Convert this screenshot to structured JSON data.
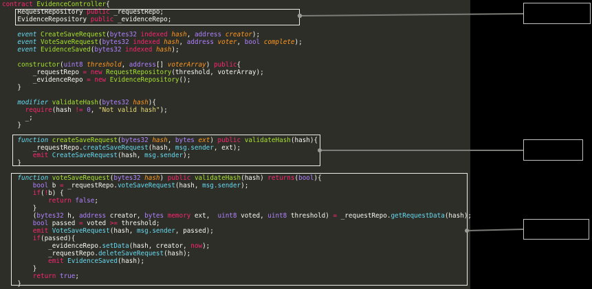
{
  "colors": {
    "editor_background": "#2e2e28",
    "side_panel_background": "#000000",
    "keyword": "#f92672",
    "declaration_keyword": "#66d9ef",
    "definition_name": "#a6e22e",
    "type": "#ae81ff",
    "parameter": "#fd971f",
    "member_call": "#66d9ef",
    "string": "#e6db74",
    "plain_text": "#f8f8f2",
    "highlight_box_border": "#eeeeea",
    "annotation_box_border": "#c4c4c2",
    "connector_line": "#7c7c78"
  },
  "code": {
    "lines": [
      [
        {
          "c": "kw",
          "t": "contract "
        },
        {
          "c": "name",
          "t": "EvidenceController"
        },
        {
          "c": "plain",
          "t": "{"
        }
      ],
      [
        {
          "c": "plain",
          "t": "    RequestRepository "
        },
        {
          "c": "kw",
          "t": "public"
        },
        {
          "c": "plain",
          "t": " _requestRepo;"
        }
      ],
      [
        {
          "c": "plain",
          "t": "    EvidenceRepository "
        },
        {
          "c": "kw",
          "t": "public"
        },
        {
          "c": "plain",
          "t": " _evidenceRepo;"
        }
      ],
      [],
      [
        {
          "c": "plain",
          "t": "    "
        },
        {
          "c": "decl",
          "t": "event "
        },
        {
          "c": "name",
          "t": "CreateSaveRequest"
        },
        {
          "c": "plain",
          "t": "("
        },
        {
          "c": "type",
          "t": "bytes32"
        },
        {
          "c": "plain",
          "t": " "
        },
        {
          "c": "kw",
          "t": "indexed"
        },
        {
          "c": "plain",
          "t": " "
        },
        {
          "c": "param",
          "t": "hash"
        },
        {
          "c": "plain",
          "t": ", "
        },
        {
          "c": "type",
          "t": "address"
        },
        {
          "c": "plain",
          "t": " "
        },
        {
          "c": "param",
          "t": "creator"
        },
        {
          "c": "plain",
          "t": ");"
        }
      ],
      [
        {
          "c": "plain",
          "t": "    "
        },
        {
          "c": "decl",
          "t": "event "
        },
        {
          "c": "name",
          "t": "VoteSaveRequest"
        },
        {
          "c": "plain",
          "t": "("
        },
        {
          "c": "type",
          "t": "bytes32"
        },
        {
          "c": "plain",
          "t": " "
        },
        {
          "c": "kw",
          "t": "indexed"
        },
        {
          "c": "plain",
          "t": " "
        },
        {
          "c": "param",
          "t": "hash"
        },
        {
          "c": "plain",
          "t": ", "
        },
        {
          "c": "type",
          "t": "address"
        },
        {
          "c": "plain",
          "t": " "
        },
        {
          "c": "param",
          "t": "voter"
        },
        {
          "c": "plain",
          "t": ", "
        },
        {
          "c": "type",
          "t": "bool"
        },
        {
          "c": "plain",
          "t": " "
        },
        {
          "c": "param",
          "t": "complete"
        },
        {
          "c": "plain",
          "t": ");"
        }
      ],
      [
        {
          "c": "plain",
          "t": "    "
        },
        {
          "c": "decl",
          "t": "event "
        },
        {
          "c": "name",
          "t": "EvidenceSaved"
        },
        {
          "c": "plain",
          "t": "("
        },
        {
          "c": "type",
          "t": "bytes32"
        },
        {
          "c": "plain",
          "t": " "
        },
        {
          "c": "kw",
          "t": "indexed"
        },
        {
          "c": "plain",
          "t": " "
        },
        {
          "c": "param",
          "t": "hash"
        },
        {
          "c": "plain",
          "t": ");"
        }
      ],
      [],
      [
        {
          "c": "plain",
          "t": "    "
        },
        {
          "c": "name",
          "t": "constructor"
        },
        {
          "c": "plain",
          "t": "("
        },
        {
          "c": "type",
          "t": "uint8"
        },
        {
          "c": "plain",
          "t": " "
        },
        {
          "c": "param",
          "t": "threshold"
        },
        {
          "c": "plain",
          "t": ", "
        },
        {
          "c": "type",
          "t": "address"
        },
        {
          "c": "plain",
          "t": "[] "
        },
        {
          "c": "param",
          "t": "voterArray"
        },
        {
          "c": "plain",
          "t": ") "
        },
        {
          "c": "kw",
          "t": "public"
        },
        {
          "c": "plain",
          "t": "{"
        }
      ],
      [
        {
          "c": "plain",
          "t": "        _requestRepo "
        },
        {
          "c": "kw",
          "t": "="
        },
        {
          "c": "plain",
          "t": " "
        },
        {
          "c": "kw",
          "t": "new"
        },
        {
          "c": "plain",
          "t": " "
        },
        {
          "c": "name",
          "t": "RequestRepository"
        },
        {
          "c": "plain",
          "t": "(threshold, voterArray);"
        }
      ],
      [
        {
          "c": "plain",
          "t": "        _evidenceRepo "
        },
        {
          "c": "kw",
          "t": "="
        },
        {
          "c": "plain",
          "t": " "
        },
        {
          "c": "kw",
          "t": "new"
        },
        {
          "c": "plain",
          "t": " "
        },
        {
          "c": "name",
          "t": "EvidenceRepository"
        },
        {
          "c": "plain",
          "t": "();"
        }
      ],
      [
        {
          "c": "plain",
          "t": "    }"
        }
      ],
      [],
      [
        {
          "c": "plain",
          "t": "    "
        },
        {
          "c": "decl",
          "t": "modifier "
        },
        {
          "c": "name",
          "t": "validateHash"
        },
        {
          "c": "plain",
          "t": "("
        },
        {
          "c": "type",
          "t": "bytes32"
        },
        {
          "c": "plain",
          "t": " "
        },
        {
          "c": "param",
          "t": "hash"
        },
        {
          "c": "plain",
          "t": "){"
        }
      ],
      [
        {
          "c": "plain",
          "t": "      "
        },
        {
          "c": "kw",
          "t": "require"
        },
        {
          "c": "plain",
          "t": "(hash "
        },
        {
          "c": "kw",
          "t": "!="
        },
        {
          "c": "plain",
          "t": " "
        },
        {
          "c": "type",
          "t": "0"
        },
        {
          "c": "plain",
          "t": ", "
        },
        {
          "c": "str",
          "t": "\"Not valid hash\""
        },
        {
          "c": "plain",
          "t": ");"
        }
      ],
      [
        {
          "c": "plain",
          "t": "      _;"
        }
      ],
      [
        {
          "c": "plain",
          "t": "    }"
        }
      ],
      [],
      [
        {
          "c": "plain",
          "t": "    "
        },
        {
          "c": "decl",
          "t": "function "
        },
        {
          "c": "name",
          "t": "createSaveRequest"
        },
        {
          "c": "plain",
          "t": "("
        },
        {
          "c": "type",
          "t": "bytes32"
        },
        {
          "c": "plain",
          "t": " "
        },
        {
          "c": "param",
          "t": "hash"
        },
        {
          "c": "plain",
          "t": ", "
        },
        {
          "c": "type",
          "t": "bytes"
        },
        {
          "c": "plain",
          "t": " "
        },
        {
          "c": "param",
          "t": "ext"
        },
        {
          "c": "plain",
          "t": ") "
        },
        {
          "c": "kw",
          "t": "public"
        },
        {
          "c": "plain",
          "t": " "
        },
        {
          "c": "name",
          "t": "validateHash"
        },
        {
          "c": "plain",
          "t": "(hash){"
        }
      ],
      [
        {
          "c": "plain",
          "t": "        _requestRepo."
        },
        {
          "c": "member",
          "t": "createSaveRequest"
        },
        {
          "c": "plain",
          "t": "(hash, "
        },
        {
          "c": "member",
          "t": "msg.sender"
        },
        {
          "c": "plain",
          "t": ", ext);"
        }
      ],
      [
        {
          "c": "plain",
          "t": "        "
        },
        {
          "c": "kw",
          "t": "emit"
        },
        {
          "c": "plain",
          "t": " "
        },
        {
          "c": "member",
          "t": "CreateSaveRequest"
        },
        {
          "c": "plain",
          "t": "(hash, "
        },
        {
          "c": "member",
          "t": "msg.sender"
        },
        {
          "c": "plain",
          "t": ");"
        }
      ],
      [
        {
          "c": "plain",
          "t": "    }"
        }
      ],
      [],
      [
        {
          "c": "plain",
          "t": "    "
        },
        {
          "c": "decl",
          "t": "function "
        },
        {
          "c": "name",
          "t": "voteSaveRequest"
        },
        {
          "c": "plain",
          "t": "("
        },
        {
          "c": "type",
          "t": "bytes32"
        },
        {
          "c": "plain",
          "t": " "
        },
        {
          "c": "param",
          "t": "hash"
        },
        {
          "c": "plain",
          "t": ") "
        },
        {
          "c": "kw",
          "t": "public"
        },
        {
          "c": "plain",
          "t": " "
        },
        {
          "c": "name",
          "t": "validateHash"
        },
        {
          "c": "plain",
          "t": "(hash) "
        },
        {
          "c": "kw",
          "t": "returns"
        },
        {
          "c": "plain",
          "t": "("
        },
        {
          "c": "type",
          "t": "bool"
        },
        {
          "c": "plain",
          "t": "){"
        }
      ],
      [
        {
          "c": "plain",
          "t": "        "
        },
        {
          "c": "type",
          "t": "bool"
        },
        {
          "c": "plain",
          "t": " b "
        },
        {
          "c": "kw",
          "t": "="
        },
        {
          "c": "plain",
          "t": " _requestRepo."
        },
        {
          "c": "member",
          "t": "voteSaveRequest"
        },
        {
          "c": "plain",
          "t": "(hash, "
        },
        {
          "c": "member",
          "t": "msg.sender"
        },
        {
          "c": "plain",
          "t": ");"
        }
      ],
      [
        {
          "c": "plain",
          "t": "        "
        },
        {
          "c": "kw",
          "t": "if"
        },
        {
          "c": "plain",
          "t": "("
        },
        {
          "c": "kw",
          "t": "!"
        },
        {
          "c": "plain",
          "t": "b) {"
        }
      ],
      [
        {
          "c": "plain",
          "t": "            "
        },
        {
          "c": "kw",
          "t": "return"
        },
        {
          "c": "plain",
          "t": " "
        },
        {
          "c": "type",
          "t": "false"
        },
        {
          "c": "plain",
          "t": ";"
        }
      ],
      [
        {
          "c": "plain",
          "t": "        }"
        }
      ],
      [
        {
          "c": "plain",
          "t": "        ("
        },
        {
          "c": "type",
          "t": "bytes32"
        },
        {
          "c": "plain",
          "t": " h, "
        },
        {
          "c": "type",
          "t": "address"
        },
        {
          "c": "plain",
          "t": " creator, "
        },
        {
          "c": "type",
          "t": "bytes"
        },
        {
          "c": "plain",
          "t": " "
        },
        {
          "c": "kw",
          "t": "memory"
        },
        {
          "c": "plain",
          "t": " ext,  "
        },
        {
          "c": "type",
          "t": "uint8"
        },
        {
          "c": "plain",
          "t": " voted, "
        },
        {
          "c": "type",
          "t": "uint8"
        },
        {
          "c": "plain",
          "t": " threshold) "
        },
        {
          "c": "kw",
          "t": "="
        },
        {
          "c": "plain",
          "t": " _requestRepo."
        },
        {
          "c": "member",
          "t": "getRequestData"
        },
        {
          "c": "plain",
          "t": "(hash);"
        }
      ],
      [
        {
          "c": "plain",
          "t": "        "
        },
        {
          "c": "type",
          "t": "bool"
        },
        {
          "c": "plain",
          "t": " passed "
        },
        {
          "c": "kw",
          "t": "="
        },
        {
          "c": "plain",
          "t": " voted "
        },
        {
          "c": "kw",
          "t": ">="
        },
        {
          "c": "plain",
          "t": " threshold;"
        }
      ],
      [
        {
          "c": "plain",
          "t": "        "
        },
        {
          "c": "kw",
          "t": "emit"
        },
        {
          "c": "plain",
          "t": " "
        },
        {
          "c": "member",
          "t": "VoteSaveRequest"
        },
        {
          "c": "plain",
          "t": "(hash, "
        },
        {
          "c": "member",
          "t": "msg.sender"
        },
        {
          "c": "plain",
          "t": ", passed);"
        }
      ],
      [
        {
          "c": "plain",
          "t": "        "
        },
        {
          "c": "kw",
          "t": "if"
        },
        {
          "c": "plain",
          "t": "(passed){"
        }
      ],
      [
        {
          "c": "plain",
          "t": "            _evidenceRepo."
        },
        {
          "c": "member",
          "t": "setData"
        },
        {
          "c": "plain",
          "t": "(hash, creator, "
        },
        {
          "c": "kw",
          "t": "now"
        },
        {
          "c": "plain",
          "t": ");"
        }
      ],
      [
        {
          "c": "plain",
          "t": "            _requestRepo."
        },
        {
          "c": "member",
          "t": "deleteSaveRequest"
        },
        {
          "c": "plain",
          "t": "(hash);"
        }
      ],
      [
        {
          "c": "plain",
          "t": "            "
        },
        {
          "c": "kw",
          "t": "emit"
        },
        {
          "c": "plain",
          "t": " "
        },
        {
          "c": "member",
          "t": "EvidenceSaved"
        },
        {
          "c": "plain",
          "t": "(hash);"
        }
      ],
      [
        {
          "c": "plain",
          "t": "        }"
        }
      ],
      [
        {
          "c": "plain",
          "t": "        "
        },
        {
          "c": "kw",
          "t": "return"
        },
        {
          "c": "plain",
          "t": " "
        },
        {
          "c": "type",
          "t": "true"
        },
        {
          "c": "plain",
          "t": ";"
        }
      ],
      [
        {
          "c": "plain",
          "t": "    }"
        }
      ]
    ]
  },
  "annotations": {
    "highlight_boxes": [
      {
        "target": "state-variable-declarations"
      },
      {
        "target": "createSaveRequest-function"
      },
      {
        "target": "voteSaveRequest-function"
      }
    ],
    "label_boxes": [
      {
        "text": ""
      },
      {
        "text": ""
      },
      {
        "text": ""
      }
    ]
  }
}
